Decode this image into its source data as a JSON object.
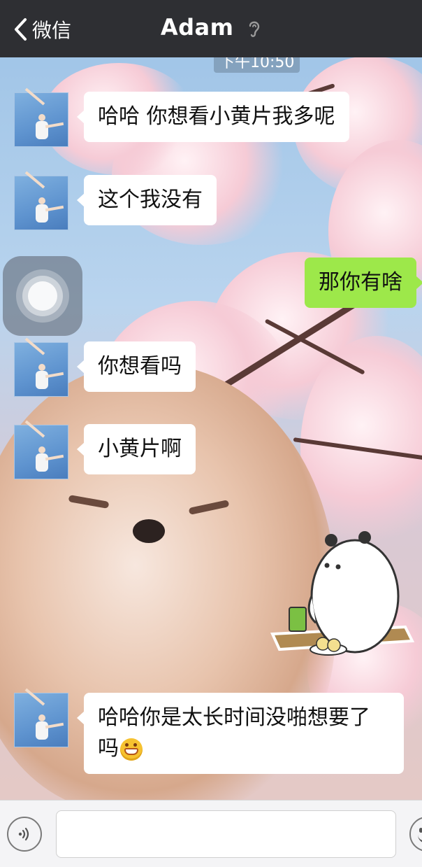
{
  "navbar": {
    "back_label": "微信",
    "title": "Adam"
  },
  "timestamp": "下午10:50",
  "messages": [
    {
      "side": "in",
      "text": "哈哈 你想看小黄片我多呢"
    },
    {
      "side": "in",
      "text": "这个我没有"
    },
    {
      "side": "out",
      "text": "那你有啥"
    },
    {
      "side": "in",
      "text": "你想看吗"
    },
    {
      "side": "in",
      "text": "小黄片啊"
    },
    {
      "side": "in",
      "text": "哈哈你是太长时间没啪想要了",
      "text_line2": "吗"
    }
  ],
  "colors": {
    "navbar": "#2e2f33",
    "outgoing_bubble": "#9de84a",
    "incoming_bubble": "#ffffff",
    "inputbar": "#f4f4f6"
  },
  "icons": {
    "back": "chevron-left-icon",
    "earpiece": "ear-icon",
    "voice": "voice-icon",
    "emoji": "emoji-icon",
    "grin": "grinning-face-icon",
    "assistive_touch": "assistive-touch-icon"
  },
  "input": {
    "value": "",
    "placeholder": ""
  }
}
